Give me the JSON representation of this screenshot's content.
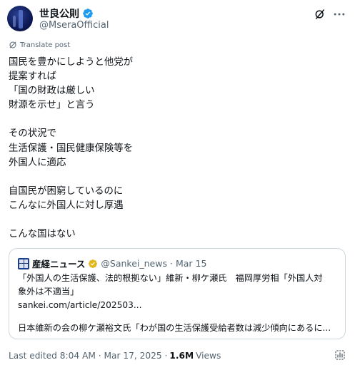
{
  "author": {
    "display_name": "世良公則",
    "handle": "@MseraOfficial",
    "verified_color": "#1d9bf0"
  },
  "translate_label": "Translate post",
  "post_lines": [
    "国民を豊かにしようと他党が",
    "提案すれば",
    "「国の財政は厳しい",
    "財源を示せ」と言う",
    "",
    "その状況で",
    "生活保護・国民健康保険等を",
    "外国人に適応",
    "",
    "自国民が困窮しているのに",
    "こんなに外国人に対し厚遇",
    "",
    "こんな国はない"
  ],
  "quote": {
    "source_name": "産経ニュース",
    "badge_color": "#e2b719",
    "handle": "@Sankei_news",
    "separator": "·",
    "date": "Mar 15",
    "headline_line1": "「外国人の生活保護、法的根拠ない」維新・柳ケ瀬氏　福岡厚労相「外国人対",
    "headline_line2": "象外は不適当」",
    "link": "sankei.com/article/202503...",
    "excerpt": "日本維新の会の柳ケ瀬裕文氏「わが国の生活保護受給者数は減少傾向にあるに..."
  },
  "meta": {
    "edited_label": "Last edited 8:04 AM · Mar 17, 2025 ·",
    "views_count": "1.6M",
    "views_label": "Views"
  },
  "icons": {
    "grok": "grok-icon",
    "more": "more-icon",
    "translate": "translate-icon",
    "analytics": "analytics-icon"
  }
}
